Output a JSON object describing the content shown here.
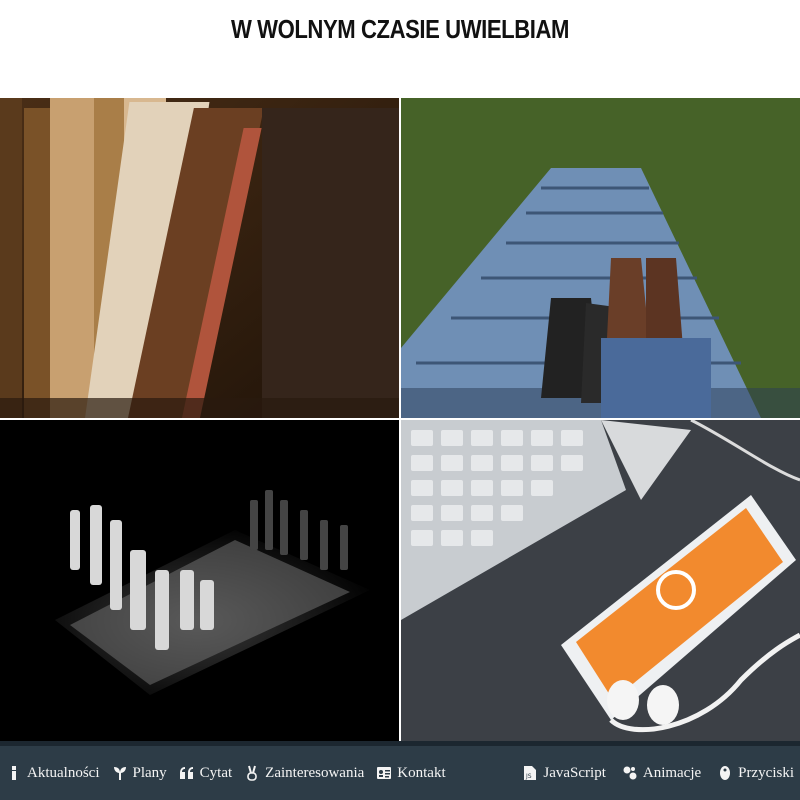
{
  "header": {
    "title": "W WOLNYM CZASIE UWIELBIAM"
  },
  "gallery": {
    "tiles": [
      {
        "subject": "old books on a shelf"
      },
      {
        "subject": "sneakers on a wooden walkway"
      },
      {
        "subject": "chess board"
      },
      {
        "subject": "keyboard and smartphone with headphones"
      }
    ]
  },
  "nav": {
    "left": [
      {
        "label": "Aktualności",
        "icon": "info-icon"
      },
      {
        "label": "Plany",
        "icon": "plant-icon"
      },
      {
        "label": "Cytat",
        "icon": "quote-icon"
      },
      {
        "label": "Zainteresowania",
        "icon": "peace-hand-icon"
      },
      {
        "label": "Kontakt",
        "icon": "contact-card-icon"
      }
    ],
    "right": [
      {
        "label": "JavaScript",
        "icon": "js-file-icon"
      },
      {
        "label": "Animacje",
        "icon": "animation-icon"
      },
      {
        "label": "Przyciski",
        "icon": "button-icon"
      }
    ]
  },
  "colors": {
    "navbar_bg": "#2d3c47",
    "navbar_border": "#1c2730",
    "nav_text": "#f4f4f4",
    "phone_screen": "#f28a2e"
  }
}
